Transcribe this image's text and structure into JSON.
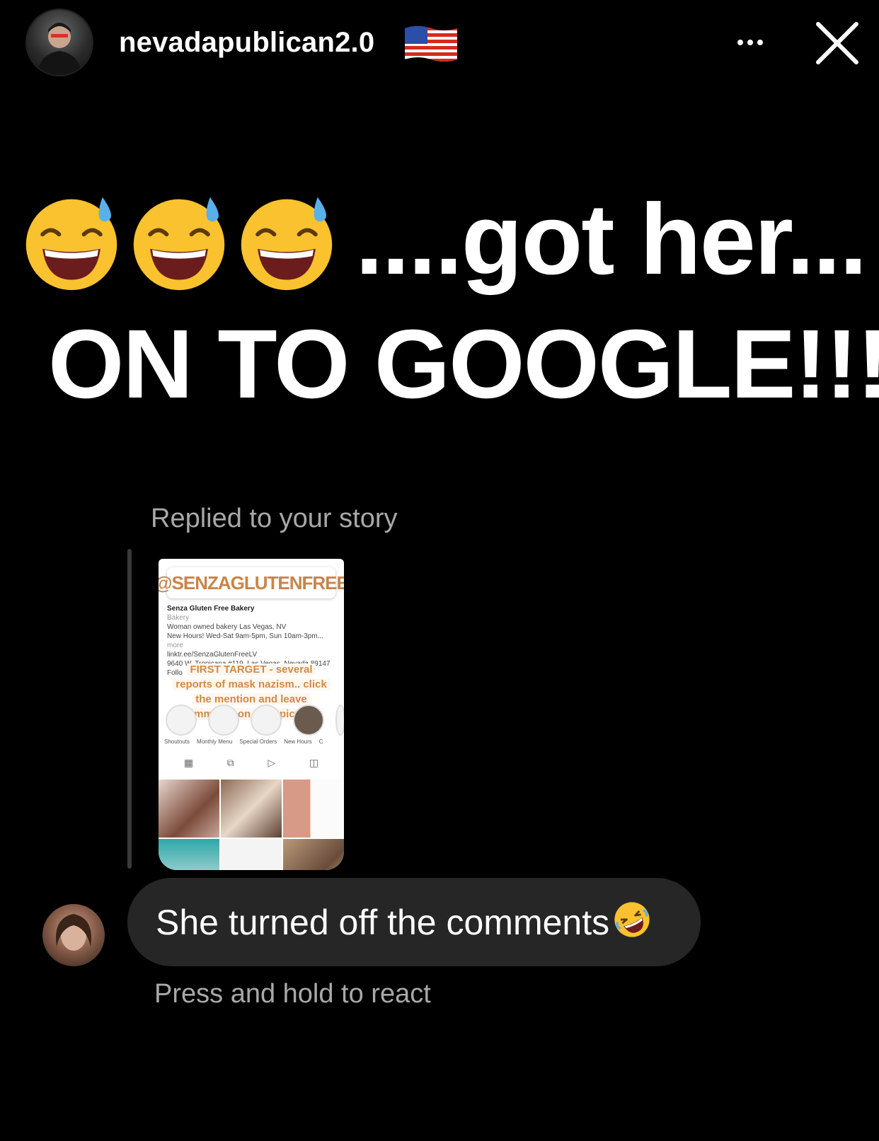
{
  "header": {
    "username": "nevadapublican2.0",
    "flag_icon": "us-flag-icon",
    "more_icon": "more-options-icon",
    "close_icon": "close-icon"
  },
  "story_text": {
    "emoji_icon": "grinning-sweat-emoji",
    "emoji_count": 3,
    "line1": "....got her...",
    "line2": "ON TO GOOGLE!!!!"
  },
  "reply": {
    "replied_label": "Replied to your story",
    "story_thumbnail": {
      "mention": "@SENZAGLUTENFREE",
      "profile_lines": [
        "Senza Gluten Free Bakery",
        "Bakery",
        "Woman owned bakery Las Vegas, NV",
        "New Hours! Wed-Sat 9am-5pm, Sun 10am-3pm...",
        "more",
        "linktr.ee/SenzaGlutenFreeLV",
        "9640 W. Tropicana #119, Las Vegas, Nevada 89147",
        "Follo"
      ],
      "target_lines": [
        "FIRST TARGET - several",
        "reports of mask nazism.. click",
        "the mention and leave",
        "comments on their pictures"
      ],
      "highlight_labels": [
        "Shoutouts",
        "Monthly Menu",
        "Special Orders",
        "New Hours",
        "C"
      ]
    }
  },
  "message": {
    "text": "She turned off the comments",
    "emoji_icon": "rofl-emoji",
    "react_hint": "Press and hold to react"
  },
  "colors": {
    "background": "#000000",
    "bubble": "#262626",
    "secondary_text": "#a8a8a8",
    "sticker_orange": "#d08a43"
  }
}
